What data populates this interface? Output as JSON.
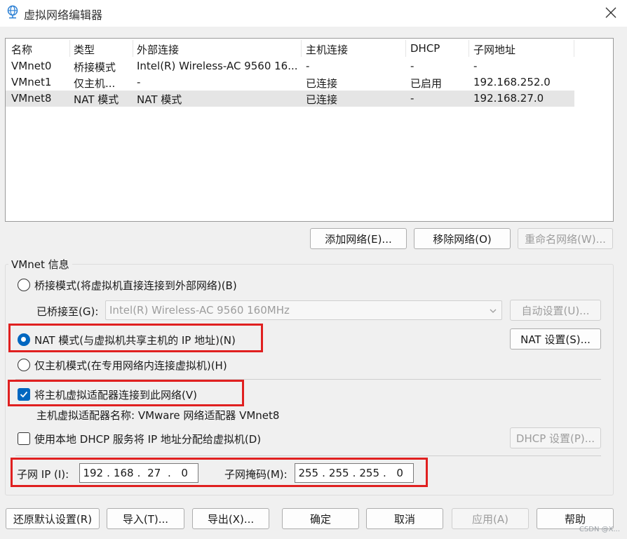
{
  "window": {
    "title": "虚拟网络编辑器"
  },
  "table": {
    "columns": [
      "名称",
      "类型",
      "外部连接",
      "主机连接",
      "DHCP",
      "子网地址"
    ],
    "rows": [
      [
        "VMnet0",
        "桥接模式",
        "Intel(R) Wireless-AC 9560 16...",
        "-",
        "-",
        "-"
      ],
      [
        "VMnet1",
        "仅主机...",
        "-",
        "已连接",
        "已启用",
        "192.168.252.0"
      ],
      [
        "VMnet8",
        "NAT 模式",
        "NAT 模式",
        "已连接",
        "-",
        "192.168.27.0"
      ]
    ],
    "selected_row": 2
  },
  "network_buttons": {
    "add": "添加网络(E)...",
    "remove": "移除网络(O)",
    "rename": "重命名网络(W)..."
  },
  "vmnet_info": {
    "group_label": "VMnet 信息",
    "bridged_label": "桥接模式(将虚拟机直接连接到外部网络)(B)",
    "bridged_to_label": "已桥接至(G):",
    "bridged_to_value": "Intel(R) Wireless-AC 9560 160MHz",
    "auto_settings": "自动设置(U)...",
    "nat_label": "NAT 模式(与虚拟机共享主机的 IP 地址)(N)",
    "nat_settings": "NAT 设置(S)...",
    "host_only_label": "仅主机模式(在专用网络内连接虚拟机)(H)",
    "connect_adapter_label": "将主机虚拟适配器连接到此网络(V)",
    "adapter_name_label": "主机虚拟适配器名称: VMware 网络适配器 VMnet8",
    "dhcp_label": "使用本地 DHCP 服务将 IP 地址分配给虚拟机(D)",
    "dhcp_settings": "DHCP 设置(P)...",
    "subnet_ip_label": "子网 IP (I):",
    "subnet_ip": [
      "192",
      "168",
      "27",
      "0"
    ],
    "subnet_mask_label": "子网掩码(M):",
    "subnet_mask": [
      "255",
      "255",
      "255",
      "0"
    ],
    "selected_mode": "nat",
    "connect_adapter_checked": true,
    "dhcp_checked": false
  },
  "footer_buttons": {
    "restore": "还原默认设置(R)",
    "import": "导入(T)...",
    "export": "导出(X)...",
    "ok": "确定",
    "cancel": "取消",
    "apply": "应用(A)",
    "help": "帮助"
  },
  "watermark": "CSDN @X...",
  "colors": {
    "accent": "#0067c0",
    "highlight_box": "#e02020",
    "selected_row": "#e5e5e5"
  }
}
